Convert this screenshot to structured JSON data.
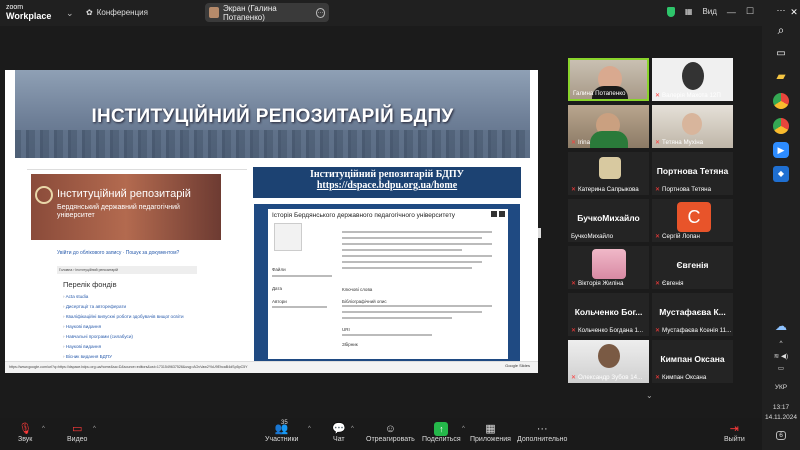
{
  "zoom": {
    "logo_line1": "zoom",
    "logo_line2": "Workplace",
    "conference_label": "Конференция",
    "share_label": "Экран (Галина Потапенко)",
    "view_label": "Вид"
  },
  "slide": {
    "banner_title": "ІНСТИТУЦІЙНИЙ РЕПОЗИТАРІЙ БДПУ",
    "site_title": "Інституційний репозитарій",
    "site_subtitle": "Бердянський державний педагогічний університет",
    "login_text": "Увійти до облікового запису · Пошук за документом?",
    "breadcrumb": "Головна › Інституційний репозитарій",
    "fonds_title": "Перелік фондів",
    "fonds": [
      "Acta studia",
      "Дисертації та автореферати",
      "Кваліфікаційні випускні роботи здобувачів вищої освіти",
      "Наукові видання",
      "Навчальні програми (силабуси)",
      "Наукові видання",
      "Вісник видання БДПУ"
    ],
    "repo_heading": "Інституційний репозитарій БДПУ",
    "repo_url": "https://dspace.bdpu.org.ua/home",
    "item_title": "Історія Бердянського державного педагогічного університету",
    "status_url": "https://www.google.com/url?q=https://dspace.bdpu.org.ua/home&sa=D&source=editors&ust=1731549637526&usg=AOvVaw2YkU9EhcaB4dSp5pC5Y",
    "slides_label": "Google Slides",
    "labels": {
      "files": "Файли",
      "date": "Дата",
      "authors": "Автори",
      "keywords": "Ключові слова",
      "citation": "Бібліографічний опис",
      "uri": "URI",
      "collection": "Збірник"
    }
  },
  "participants": [
    {
      "name": "Галина Потапенко",
      "muted": false,
      "active": true
    },
    {
      "name": "Валерія Махота 12П",
      "muted": true
    },
    {
      "name": "Irina",
      "muted": true
    },
    {
      "name": "Тетяна Мухіна",
      "muted": true
    },
    {
      "name": "Катерина Сапрыкова",
      "muted": true
    },
    {
      "name": "Портнова Тетяна",
      "big": "Портнова Тетяна",
      "muted": true
    },
    {
      "name": "БучкоМихайло",
      "big": "БучкоМихайло",
      "muted": false
    },
    {
      "name": "Сергій Лопан",
      "avatar_letter": "С",
      "muted": true
    },
    {
      "name": "Вікторія Жиліна",
      "muted": true
    },
    {
      "name": "Євгенія",
      "big": "Євгенія",
      "muted": true
    },
    {
      "name": "Кольченко Богдана 1...",
      "big": "Кольченко Бог...",
      "muted": true
    },
    {
      "name": "Мустафаєва Ксенія 11...",
      "big": "Мустафаєва К...",
      "muted": true
    },
    {
      "name": "Олександр Зубов 14...",
      "muted": true
    },
    {
      "name": "Кимпан Оксана",
      "big": "Кимпан Оксана",
      "muted": true
    }
  ],
  "toolbar": {
    "audio": "Звук",
    "video": "Видео",
    "participants": "Участники",
    "participants_count": "35",
    "chat": "Чат",
    "react": "Отреагировать",
    "share": "Поделиться",
    "apps": "Приложения",
    "more": "Дополнительно",
    "leave": "Выйти"
  },
  "taskbar": {
    "lang": "УКР",
    "time": "13:17",
    "date": "14.11.2024",
    "notif_count": "6"
  },
  "colors": {
    "active_border": "#8ad42c",
    "muted_red": "#ff3b3b",
    "share_green": "#25b84a",
    "repo_blue": "#1c4272"
  }
}
